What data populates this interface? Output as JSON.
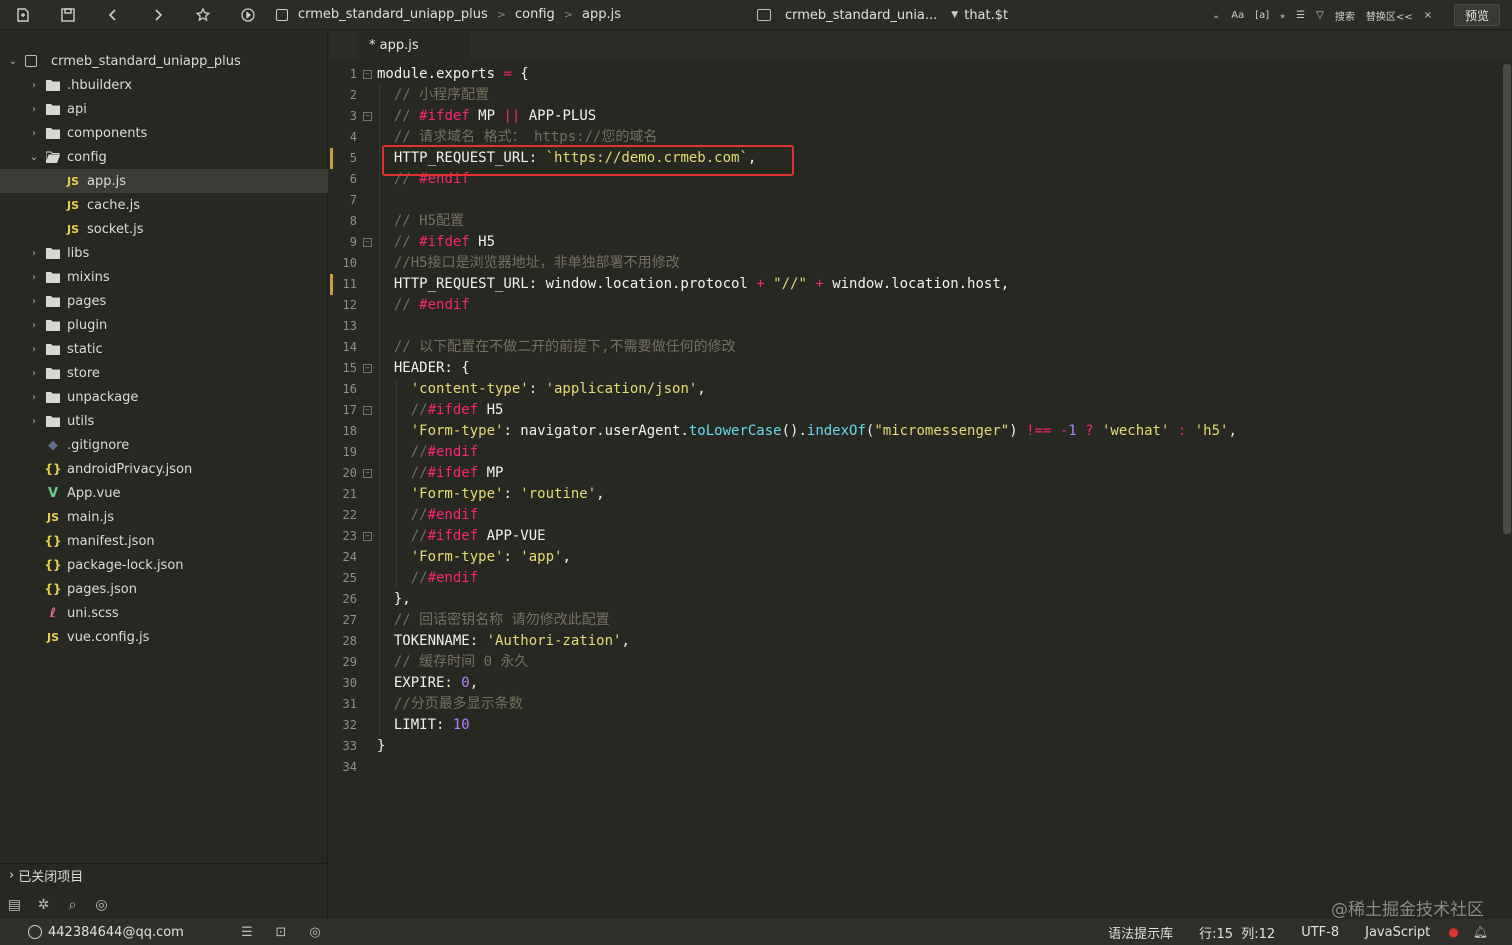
{
  "toolbar": {
    "breadcrumb": [
      "crmeb_standard_uniapp_plus",
      "config",
      "app.js"
    ],
    "search_project": "crmeb_standard_unia...",
    "search_text": "that.$t",
    "right_tools": [
      "Aa",
      "[a]",
      "⁎",
      "☰",
      "▽",
      "搜索",
      "替换区<<",
      "×"
    ],
    "preview_label": "预览"
  },
  "sidebar": {
    "project": "crmeb_standard_uniapp_plus",
    "items": [
      {
        "label": ".hbuilderx",
        "type": "folder",
        "expanded": false
      },
      {
        "label": "api",
        "type": "folder",
        "expanded": false
      },
      {
        "label": "components",
        "type": "folder",
        "expanded": false
      },
      {
        "label": "config",
        "type": "folder",
        "expanded": true
      },
      {
        "label": "app.js",
        "type": "js",
        "child": true,
        "selected": true
      },
      {
        "label": "cache.js",
        "type": "js",
        "child": true
      },
      {
        "label": "socket.js",
        "type": "js",
        "child": true
      },
      {
        "label": "libs",
        "type": "folder",
        "expanded": false
      },
      {
        "label": "mixins",
        "type": "folder",
        "expanded": false
      },
      {
        "label": "pages",
        "type": "folder",
        "expanded": false
      },
      {
        "label": "plugin",
        "type": "folder",
        "expanded": false
      },
      {
        "label": "static",
        "type": "folder",
        "expanded": false
      },
      {
        "label": "store",
        "type": "folder",
        "expanded": false
      },
      {
        "label": "unpackage",
        "type": "folder",
        "expanded": false
      },
      {
        "label": "utils",
        "type": "folder",
        "expanded": false
      },
      {
        "label": ".gitignore",
        "type": "git"
      },
      {
        "label": "androidPrivacy.json",
        "type": "json"
      },
      {
        "label": "App.vue",
        "type": "vue"
      },
      {
        "label": "main.js",
        "type": "js"
      },
      {
        "label": "manifest.json",
        "type": "json"
      },
      {
        "label": "package-lock.json",
        "type": "json"
      },
      {
        "label": "pages.json",
        "type": "json"
      },
      {
        "label": "uni.scss",
        "type": "scss"
      },
      {
        "label": "vue.config.js",
        "type": "js"
      }
    ],
    "closed_projects_label": "已关闭项目"
  },
  "editor": {
    "tab_label": "* app.js",
    "lines": [
      [
        [
          "pl",
          "module.exports "
        ],
        [
          "kw",
          "="
        ],
        [
          "pl",
          " {"
        ]
      ],
      [
        [
          "cm",
          "  // 小程序配置"
        ]
      ],
      [
        [
          "cm",
          "  // "
        ],
        [
          "kw",
          "#ifdef"
        ],
        [
          "pl",
          " MP "
        ],
        [
          "kw",
          "||"
        ],
        [
          "pl",
          " APP-PLUS"
        ]
      ],
      [
        [
          "cm",
          "  // 请求域名 格式： https://您的域名"
        ]
      ],
      [
        [
          "pl",
          "  HTTP_REQUEST_URL: "
        ],
        [
          "str",
          "`https://demo.crmeb.com`"
        ],
        [
          "pl",
          ","
        ]
      ],
      [
        [
          "cm",
          "  // "
        ],
        [
          "kw",
          "#endif"
        ]
      ],
      [],
      [
        [
          "cm",
          "  // H5配置"
        ]
      ],
      [
        [
          "cm",
          "  // "
        ],
        [
          "kw",
          "#ifdef"
        ],
        [
          "pl",
          " H5"
        ]
      ],
      [
        [
          "cm",
          "  //H5接口是浏览器地址，非单独部署不用修改"
        ]
      ],
      [
        [
          "pl",
          "  HTTP_REQUEST_URL: window.location.protocol "
        ],
        [
          "kw",
          "+"
        ],
        [
          "pl",
          " "
        ],
        [
          "str",
          "\"//\""
        ],
        [
          "pl",
          " "
        ],
        [
          "kw",
          "+"
        ],
        [
          "pl",
          " window.location.host,"
        ]
      ],
      [
        [
          "cm",
          "  // "
        ],
        [
          "kw",
          "#endif"
        ]
      ],
      [],
      [
        [
          "cm",
          "  // 以下配置在不做二开的前提下,不需要做任何的修改"
        ]
      ],
      [
        [
          "pl",
          "  HEADER: {"
        ]
      ],
      [
        [
          "str",
          "    'content-type'"
        ],
        [
          "pl",
          ": "
        ],
        [
          "str",
          "'application/json'"
        ],
        [
          "pl",
          ","
        ]
      ],
      [
        [
          "cm",
          "    //"
        ],
        [
          "kw",
          "#ifdef"
        ],
        [
          "pl",
          " H5"
        ]
      ],
      [
        [
          "str",
          "    'Form-type'"
        ],
        [
          "pl",
          ": navigator.userAgent."
        ],
        [
          "fn",
          "toLowerCase"
        ],
        [
          "pl",
          "()."
        ],
        [
          "fn",
          "indexOf"
        ],
        [
          "pl",
          "("
        ],
        [
          "str",
          "\"micromessenger\""
        ],
        [
          "pl",
          ") "
        ],
        [
          "kw",
          "!=="
        ],
        [
          "pl",
          " "
        ],
        [
          "kw",
          "-"
        ],
        [
          "num",
          "1"
        ],
        [
          "pl",
          " "
        ],
        [
          "kw",
          "?"
        ],
        [
          "pl",
          " "
        ],
        [
          "str",
          "'wechat'"
        ],
        [
          "pl",
          " "
        ],
        [
          "kw",
          ":"
        ],
        [
          "pl",
          " "
        ],
        [
          "str",
          "'h5'"
        ],
        [
          "pl",
          ","
        ]
      ],
      [
        [
          "cm",
          "    //"
        ],
        [
          "kw",
          "#endif"
        ]
      ],
      [
        [
          "cm",
          "    //"
        ],
        [
          "kw",
          "#ifdef"
        ],
        [
          "pl",
          " MP"
        ]
      ],
      [
        [
          "str",
          "    'Form-type'"
        ],
        [
          "pl",
          ": "
        ],
        [
          "str",
          "'routine'"
        ],
        [
          "pl",
          ","
        ]
      ],
      [
        [
          "cm",
          "    //"
        ],
        [
          "kw",
          "#endif"
        ]
      ],
      [
        [
          "cm",
          "    //"
        ],
        [
          "kw",
          "#ifdef"
        ],
        [
          "pl",
          " APP-VUE"
        ]
      ],
      [
        [
          "str",
          "    'Form-type'"
        ],
        [
          "pl",
          ": "
        ],
        [
          "str",
          "'app'"
        ],
        [
          "pl",
          ","
        ]
      ],
      [
        [
          "cm",
          "    //"
        ],
        [
          "kw",
          "#endif"
        ]
      ],
      [
        [
          "pl",
          "  },"
        ]
      ],
      [
        [
          "cm",
          "  // 回话密钥名称 请勿修改此配置"
        ]
      ],
      [
        [
          "pl",
          "  TOKENNAME: "
        ],
        [
          "str",
          "'Authori-zation'"
        ],
        [
          "pl",
          ","
        ]
      ],
      [
        [
          "cm",
          "  // 缓存时间 0 永久"
        ]
      ],
      [
        [
          "pl",
          "  EXPIRE: "
        ],
        [
          "num",
          "0"
        ],
        [
          "pl",
          ","
        ]
      ],
      [
        [
          "cm",
          "  //分页最多显示条数"
        ]
      ],
      [
        [
          "pl",
          "  LIMIT: "
        ],
        [
          "num",
          "10"
        ]
      ],
      [
        [
          "pl",
          "}"
        ]
      ],
      []
    ],
    "fold_lines": [
      1,
      3,
      9,
      15,
      17,
      20,
      23
    ],
    "modified_lines": [
      5,
      11
    ]
  },
  "watermark": "@稀土掘金技术社区",
  "statusbar": {
    "user": "442384644@qq.com",
    "hint_lib": "语法提示库",
    "cursor": "行:15  列:12",
    "encoding": "UTF-8",
    "language": "JavaScript"
  },
  "colors": {
    "background": "#272822",
    "keyword": "#f92672",
    "string": "#e6db74",
    "comment": "#75715e",
    "number": "#ae81ff",
    "function": "#66d9ef",
    "highlight_box": "#e0332f"
  }
}
